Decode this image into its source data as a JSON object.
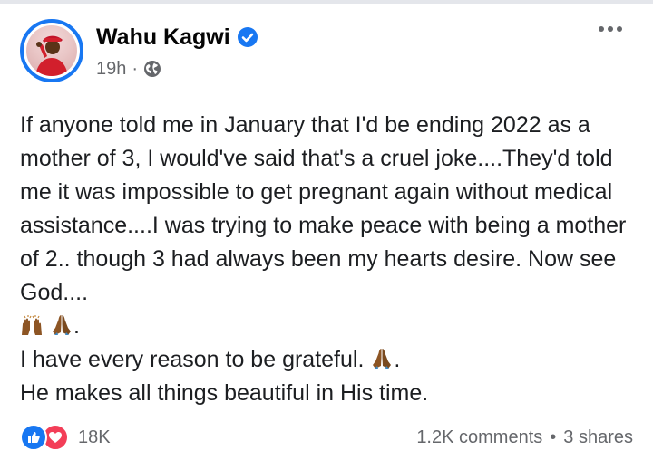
{
  "post": {
    "author": "Wahu Kagwi",
    "time": "19h",
    "separator": "·",
    "text_lines": [
      "If anyone told me in January that I'd be ending 2022 as a mother of 3, I would've said that's a cruel joke....They'd told me it was impossible to get pregnant again without medical assistance....I was trying to make peace with being a mother of 2.. though 3 had always been my hearts desire. Now see God...."
    ],
    "emoji_line_end": ".",
    "line_grateful": "I have every reason to be grateful.",
    "line_grateful_end": ".",
    "line_time": "He makes all things beautiful in His time."
  },
  "footer": {
    "reaction_count": "18K",
    "comments": "1.2K comments",
    "dot": "•",
    "shares": "3 shares"
  },
  "icons": {
    "verified": "verified-badge-icon",
    "privacy": "globe-icon",
    "more": "more-options-icon",
    "like": "like-reaction-icon",
    "love": "love-reaction-icon",
    "raising_hands": "raising-hands-emoji",
    "praying_hands": "praying-hands-emoji"
  },
  "colors": {
    "accent": "#1877f2",
    "love": "#f33e58",
    "secondary_text": "#65676b",
    "emoji_skin": "#8d5524"
  }
}
